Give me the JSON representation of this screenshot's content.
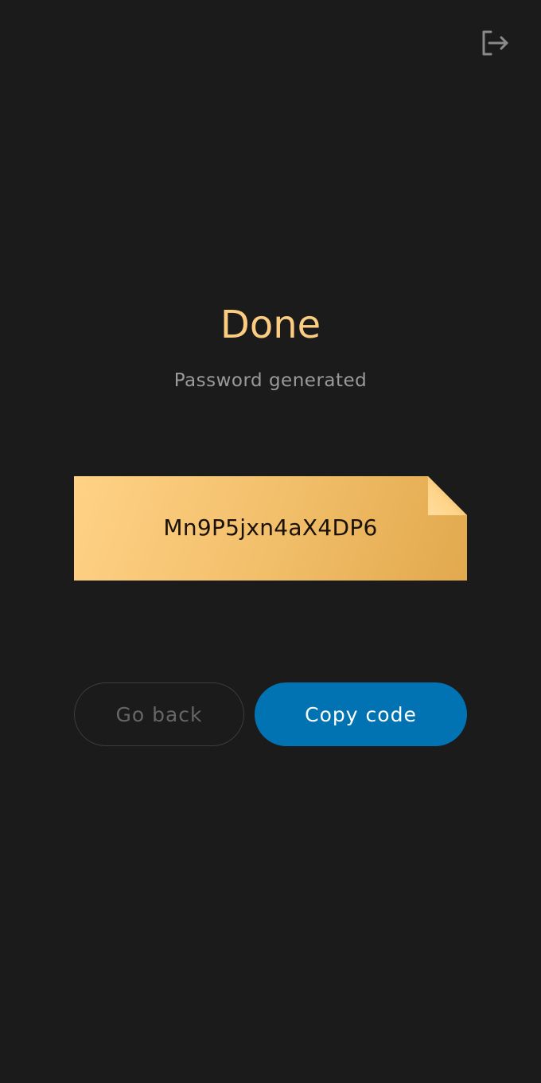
{
  "header": {
    "logout_icon": "logout-icon"
  },
  "result": {
    "title": "Done",
    "subtitle": "Password generated",
    "code": "Mn9P5jxn4aX4DP6"
  },
  "actions": {
    "back_label": "Go back",
    "copy_label": "Copy code"
  },
  "colors": {
    "background": "#1b1b1c",
    "accent": "#fccc80",
    "primary_button": "#0173b3",
    "note_gold": "#f2bf6b"
  }
}
